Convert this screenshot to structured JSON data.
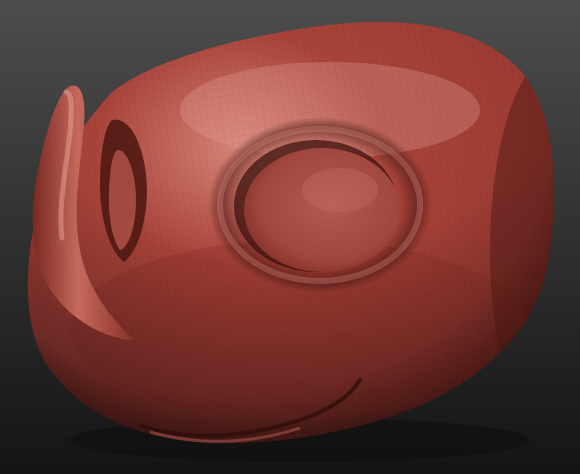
{
  "scene": {
    "subject": "sculpted-creature-head",
    "background_colors": {
      "top": "#4d4d4d",
      "bottom": "#141414"
    },
    "material_colors": {
      "base": "#a8433a",
      "highlight": "#d78478",
      "mid": "#9b3b33",
      "shadow": "#5e1f1a",
      "deep_shadow": "#3a120f"
    },
    "wireframe_visible": true
  }
}
